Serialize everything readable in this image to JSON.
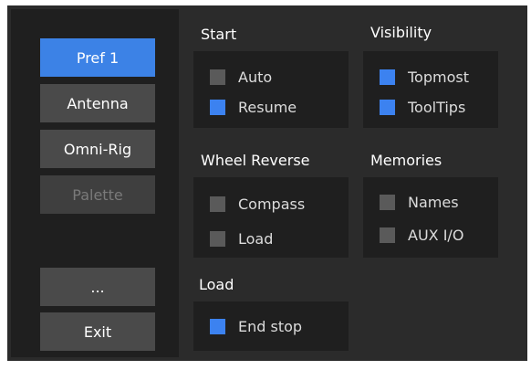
{
  "nav": {
    "pref1": "Pref 1",
    "antenna": "Antenna",
    "omnirig": "Omni-Rig",
    "palette": "Palette",
    "more": "...",
    "exit": "Exit"
  },
  "groups": {
    "start": {
      "title": "Start",
      "auto": "Auto",
      "resume": "Resume"
    },
    "visibility": {
      "title": "Visibility",
      "topmost": "Topmost",
      "tooltips": "ToolTips"
    },
    "wheel_reverse": {
      "title": "Wheel Reverse",
      "compass": "Compass",
      "load": "Load"
    },
    "memories": {
      "title": "Memories",
      "names": "Names",
      "aux_io": "AUX I/O"
    },
    "load": {
      "title": "Load",
      "end_stop": "End stop"
    }
  },
  "checked": {
    "auto": false,
    "resume": true,
    "topmost": true,
    "tooltips": true,
    "compass": false,
    "wheel_load": false,
    "names": false,
    "aux_io": false,
    "end_stop": true
  },
  "colors": {
    "accent": "#3c82e6",
    "checkbox_on": "#3c82f0",
    "checkbox_off": "#5a5a5a",
    "background": "#2b2b2b",
    "panel": "#1f1f1f"
  }
}
